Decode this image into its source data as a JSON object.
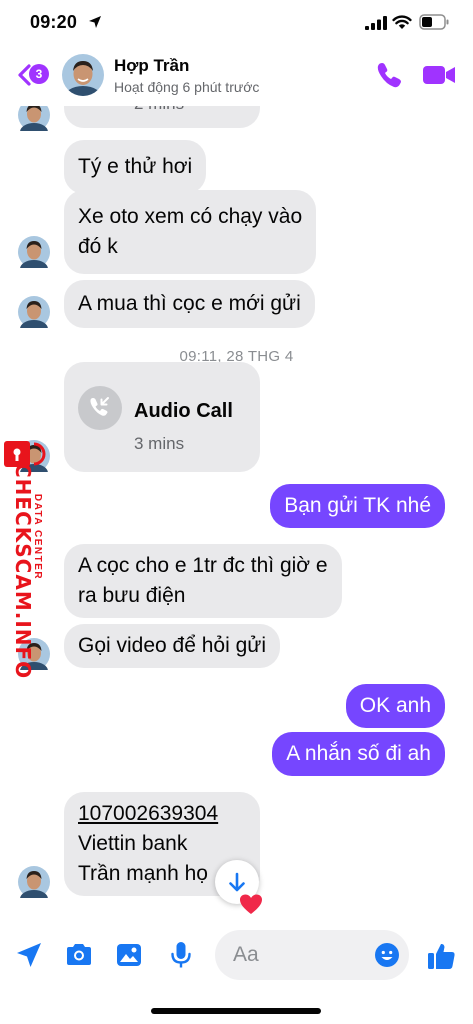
{
  "status_bar": {
    "time": "09:20"
  },
  "header": {
    "unread_count": "3",
    "contact_name": "Hợp Trần",
    "contact_status": "Hoạt động 6 phút trước"
  },
  "colors": {
    "accent": "#7646ff",
    "badge": "#a033ff",
    "incoming_bubble": "#e9e9eb",
    "watermark": "#e8141c"
  },
  "messages": {
    "partial_top": "2 mins",
    "in_1": "Tý e thử hơi",
    "in_2_line1": "Xe oto xem có chạy vào",
    "in_2_line2": "đó k",
    "in_3": "A mua thì cọc e mới gửi",
    "timestamp": "09:11, 28 THG 4",
    "call_title": "Audio Call",
    "call_duration": "3 mins",
    "out_1": "Bạn gửi TK nhé",
    "in_4_line1": "A cọc cho e 1tr đc thì giờ e",
    "in_4_line2": "ra bưu điện",
    "in_5": "Gọi video để hỏi gửi",
    "out_2": "OK anh",
    "out_3": "A nhắn số đi ah",
    "acct_number": "107002639304",
    "bank_name": "Viettin bank",
    "acct_holder": "Trần mạnh họ"
  },
  "watermark": {
    "brand": "CHECKSCAM.INFO",
    "sub": "DATA CENTER"
  },
  "composer": {
    "placeholder": "Aa"
  }
}
